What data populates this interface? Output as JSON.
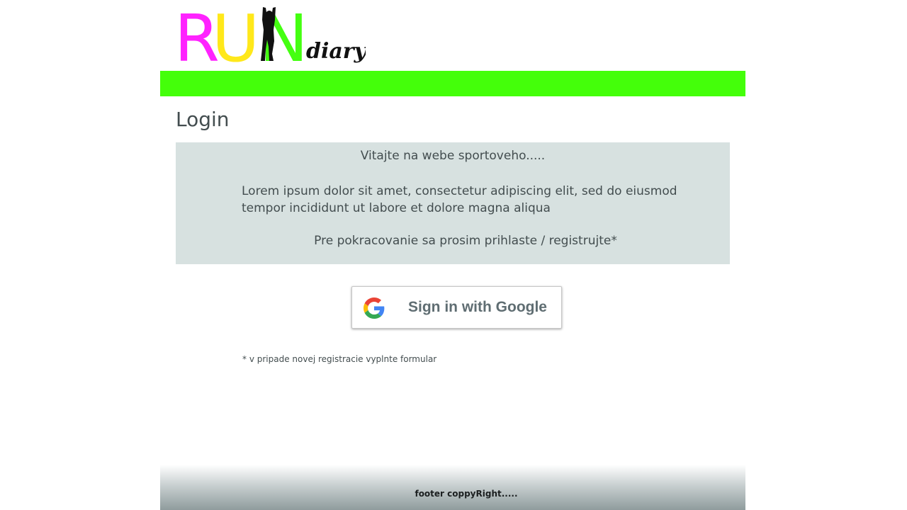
{
  "logo": {
    "letters": [
      "R",
      "U",
      "N"
    ],
    "word": "diary",
    "colors": [
      "#ff22ff",
      "#ffe81a",
      "#44ff11",
      "#111111"
    ]
  },
  "colors": {
    "nav_bar": "#44ff0a",
    "info_box_bg": "#d7e1e0",
    "text": "#434d4f"
  },
  "main": {
    "title": "Login",
    "info": {
      "welcome": "Vitajte na webe sportoveho.....",
      "lorem": "Lorem ipsum dolor sit amet, consectetur adipiscing elit, sed do eiusmod tempor incididunt ut labore et dolore magna aliqua",
      "prompt": "Pre pokracovanie sa prosim prihlaste / registrujte*"
    },
    "google_button": {
      "label": "Sign in with Google",
      "icon": "google-g-icon"
    },
    "note": "* v pripade novej registracie vyplnte formular"
  },
  "footer": {
    "copyright": "footer coppyRight....."
  }
}
